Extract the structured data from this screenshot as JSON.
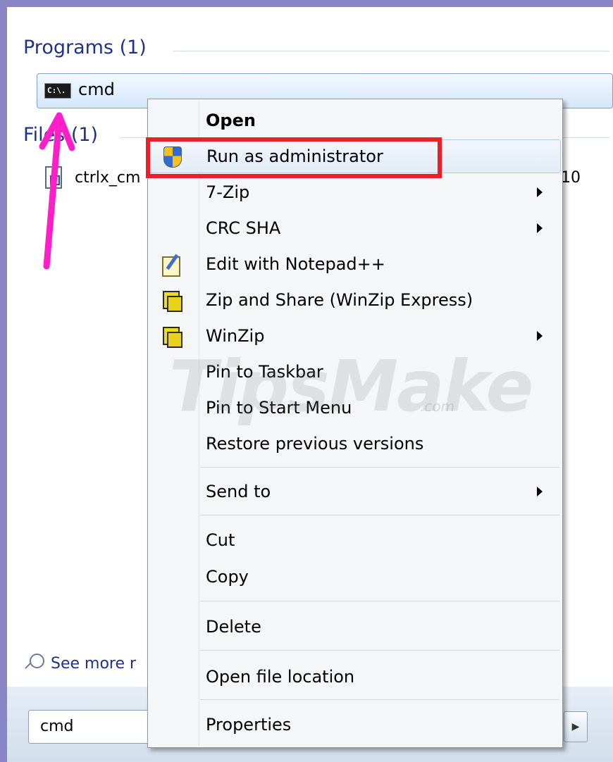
{
  "start_menu": {
    "programs_heading": "Programs (1)",
    "program_item": {
      "label": "cmd",
      "icon": "command-prompt-icon"
    },
    "files_heading": "Files (1)",
    "file_item": {
      "label": "ctrlx_cm",
      "trailing_text": "10",
      "icon": "file-icon"
    },
    "see_more": {
      "label": "See more r",
      "icon": "search-icon"
    },
    "search_box": {
      "value": "cmd"
    },
    "shutdown_options_icon": "chevron-right-icon",
    "cmd_icon_text": "C:\\."
  },
  "context_menu": {
    "items": [
      {
        "label": "Open",
        "bold": true
      },
      {
        "label": "Run as administrator",
        "icon": "uac-shield-icon",
        "hover": true
      },
      {
        "label": "7-Zip",
        "submenu": true
      },
      {
        "label": "CRC SHA",
        "submenu": true
      },
      {
        "label": "Edit with Notepad++",
        "icon": "notepad-icon"
      },
      {
        "label": "Zip and Share (WinZip Express)",
        "icon": "winzip-icon"
      },
      {
        "label": "WinZip",
        "icon": "winzip-icon",
        "submenu": true
      },
      {
        "label": "Pin to Taskbar"
      },
      {
        "label": "Pin to Start Menu"
      },
      {
        "label": "Restore previous versions"
      },
      {
        "label": "Send to",
        "submenu": true
      },
      {
        "label": "Cut"
      },
      {
        "label": "Copy"
      },
      {
        "label": "Delete"
      },
      {
        "label": "Open file location"
      },
      {
        "label": "Properties"
      }
    ]
  },
  "annotations": {
    "highlight_color": "#e8202a",
    "arrow_color": "#ff1fc8"
  },
  "watermark": {
    "text": "TipsMake",
    "suffix": ".com"
  }
}
